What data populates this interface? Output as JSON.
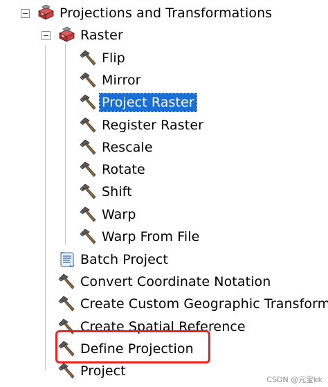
{
  "tree": {
    "root": {
      "label": "Projections and Transformations",
      "expanded": true,
      "icon": "toolbox-icon"
    },
    "raster": {
      "label": "Raster",
      "expanded": true,
      "icon": "toolbox-icon",
      "tools": [
        "Flip",
        "Mirror",
        "Project Raster",
        "Register Raster",
        "Rescale",
        "Rotate",
        "Shift",
        "Warp",
        "Warp From File"
      ],
      "selected": "Project Raster"
    },
    "tools": [
      {
        "label": "Batch Project",
        "icon": "script-icon"
      },
      {
        "label": "Convert Coordinate Notation",
        "icon": "hammer-icon"
      },
      {
        "label": "Create Custom Geographic Transform",
        "icon": "hammer-icon"
      },
      {
        "label": "Create Spatial Reference",
        "icon": "hammer-icon"
      },
      {
        "label": "Define Projection",
        "icon": "hammer-icon"
      },
      {
        "label": "Project",
        "icon": "hammer-icon"
      }
    ]
  },
  "annotation": {
    "highlighted": "Define Projection",
    "color": "#e8231f"
  },
  "watermark": "CSDN @元宝kk",
  "colors": {
    "selection_bg": "#1a6fd6",
    "selection_text": "#ffffff"
  }
}
